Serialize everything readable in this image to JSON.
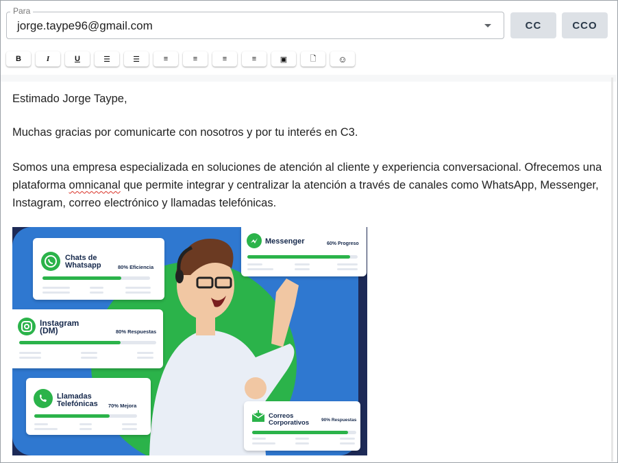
{
  "compose": {
    "to": {
      "legend": "Para",
      "value": "jorge.taype96@gmail.com"
    },
    "cc_label": "CC",
    "bcc_label": "CCO"
  },
  "toolbar": [
    {
      "icon": "bold-icon",
      "glyph": "B"
    },
    {
      "icon": "italic-icon",
      "glyph": "I"
    },
    {
      "icon": "underline-icon",
      "glyph": "U"
    },
    {
      "icon": "bullet-list-icon",
      "glyph": "☰"
    },
    {
      "icon": "numbered-list-icon",
      "glyph": "☰"
    },
    {
      "icon": "align-left-icon",
      "glyph": "≡"
    },
    {
      "icon": "align-center-icon",
      "glyph": "≡"
    },
    {
      "icon": "align-right-icon",
      "glyph": "≡"
    },
    {
      "icon": "justify-icon",
      "glyph": "≡"
    },
    {
      "icon": "image-icon",
      "glyph": "▣"
    },
    {
      "icon": "attachment-icon",
      "glyph": "🗋"
    },
    {
      "icon": "emoji-icon",
      "glyph": "☺"
    }
  ],
  "body": {
    "greeting": "Estimado Jorge Taype,",
    "line1": "Muchas gracias por comunicarte con nosotros y por tu interés en C3.",
    "line2_a": "Somos una empresa especializada en soluciones de atención al cliente y experiencia conversacional. Ofrecemos una plataforma ",
    "line2_sq": "omnicanal",
    "line2_b": " que permite integrar y centralizar la atención a través de canales como WhatsApp, Messenger, Instagram, correo electrónico y llamadas telefónicas."
  },
  "banner": {
    "colors": {
      "blue": "#2f78d0",
      "green": "#2bb34a",
      "navy": "#15284b"
    },
    "cards": {
      "whatsapp": {
        "title1": "Chats de",
        "title2": "Whatsapp",
        "stat": "80% Eficiencia",
        "progress": 0.73,
        "icon": "whatsapp-icon"
      },
      "messenger": {
        "title1": "Messenger",
        "title2": "",
        "stat": "60% Progreso",
        "progress": 0.93,
        "icon": "messenger-icon"
      },
      "instagram": {
        "title1": "Instagram",
        "title2": "(DM)",
        "stat": "80% Respuestas",
        "progress": 0.74,
        "icon": "instagram-icon"
      },
      "calls": {
        "title1": "Llamadas",
        "title2": "Telefónicas",
        "stat": "70% Mejora",
        "progress": 0.73,
        "icon": "phone-icon"
      },
      "email": {
        "title1": "Correos",
        "title2": "Corporativos",
        "stat": "90% Respuestas",
        "progress": 0.92,
        "icon": "email-icon"
      }
    }
  }
}
